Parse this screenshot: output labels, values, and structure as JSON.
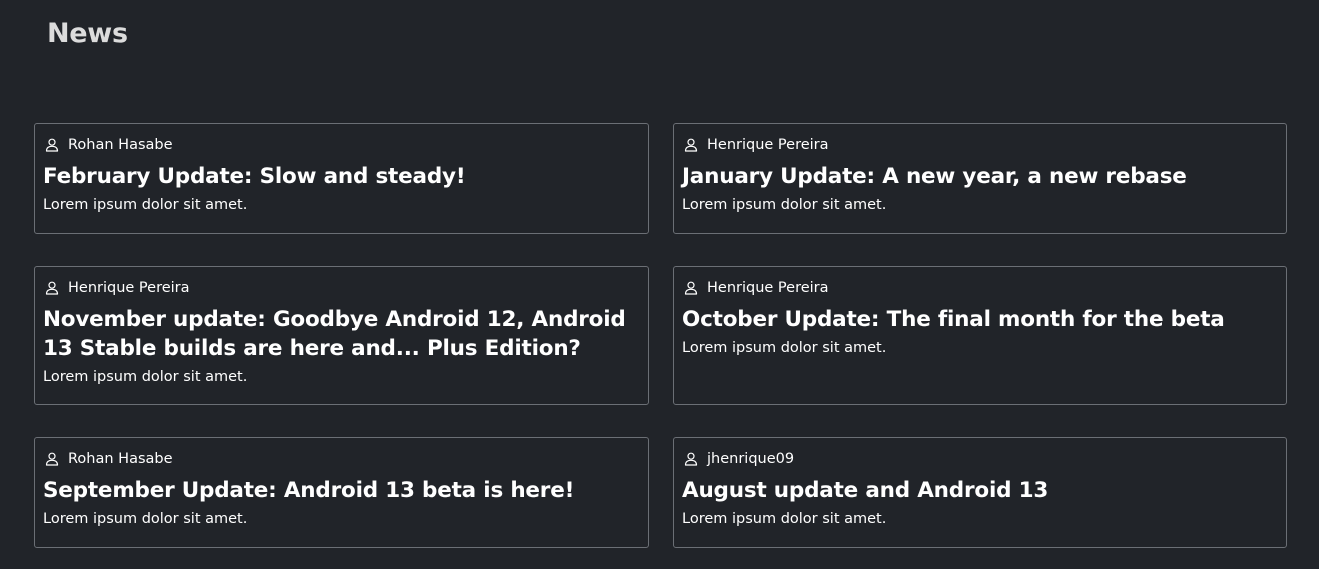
{
  "page": {
    "title": "News"
  },
  "articles": [
    {
      "author": "Rohan Hasabe",
      "title": "February Update: Slow and steady!",
      "excerpt": "Lorem ipsum dolor sit amet."
    },
    {
      "author": "Henrique Pereira",
      "title": "January Update: A new year, a new rebase",
      "excerpt": "Lorem ipsum dolor sit amet."
    },
    {
      "author": "Henrique Pereira",
      "title": "November update: Goodbye Android 12, Android 13 Stable builds are here and... Plus Edition?",
      "excerpt": "Lorem ipsum dolor sit amet."
    },
    {
      "author": "Henrique Pereira",
      "title": "October Update: The final month for the beta",
      "excerpt": "Lorem ipsum dolor sit amet."
    },
    {
      "author": "Rohan Hasabe",
      "title": "September Update: Android 13 beta is here!",
      "excerpt": "Lorem ipsum dolor sit amet."
    },
    {
      "author": "jhenrique09",
      "title": "August update and Android 13",
      "excerpt": "Lorem ipsum dolor sit amet."
    }
  ],
  "icons": {
    "author": "person-icon"
  },
  "colors": {
    "background": "#212429",
    "card_border": "#6b6f75",
    "heading": "#dcdcdc",
    "text": "#ffffff"
  }
}
